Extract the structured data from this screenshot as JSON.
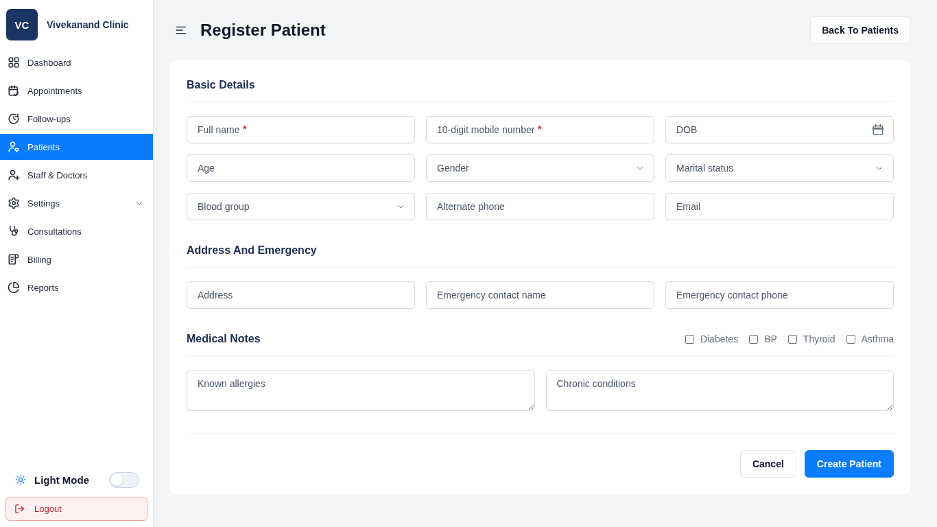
{
  "sidebar": {
    "logo": "VC",
    "brand": "Vivekanand Clinic",
    "nav": [
      {
        "label": "Dashboard",
        "selected": false
      },
      {
        "label": "Appointments",
        "selected": false
      },
      {
        "label": "Follow-ups",
        "selected": false
      },
      {
        "label": "Patients",
        "selected": true
      },
      {
        "label": "Staff & Doctors",
        "selected": false
      },
      {
        "label": "Settings",
        "selected": false,
        "expanded": false
      },
      {
        "label": "Consultations",
        "selected": false
      },
      {
        "label": "Billing",
        "selected": false
      },
      {
        "label": "Reports",
        "selected": false
      }
    ],
    "theme_toggle": {
      "label": "Light Mode",
      "on": false
    },
    "logout": "Logout"
  },
  "header": {
    "title": "Register Patient",
    "back_button": "Back To Patients"
  },
  "form": {
    "sections": [
      {
        "title": "Basic Details",
        "fields": [
          {
            "kind": "text",
            "placeholder": "Full name",
            "required_mark": "*"
          },
          {
            "kind": "text",
            "placeholder": "10-digit mobile number",
            "required_mark": "*"
          },
          {
            "kind": "date",
            "placeholder": "DOB"
          },
          {
            "kind": "text",
            "placeholder": "Age"
          },
          {
            "kind": "select",
            "placeholder": "Gender"
          },
          {
            "kind": "select",
            "placeholder": "Marital status"
          },
          {
            "kind": "select",
            "placeholder": "Blood group"
          },
          {
            "kind": "text",
            "placeholder": "Alternate phone"
          },
          {
            "kind": "text",
            "placeholder": "Email"
          }
        ]
      },
      {
        "title": "Address And Emergency",
        "fields": [
          {
            "kind": "text",
            "placeholder": "Address"
          },
          {
            "kind": "text",
            "placeholder": "Emergency contact name"
          },
          {
            "kind": "text",
            "placeholder": "Emergency contact phone"
          }
        ]
      },
      {
        "title": "Medical Notes",
        "conditions": [
          {
            "label": "Diabetes",
            "checked": false
          },
          {
            "label": "BP",
            "checked": false
          },
          {
            "label": "Thyroid",
            "checked": false
          },
          {
            "label": "Asthma",
            "checked": false
          }
        ],
        "fields": [
          {
            "kind": "textarea",
            "placeholder": "Known allergies"
          },
          {
            "kind": "textarea",
            "placeholder": "Chronic conditions"
          }
        ]
      }
    ],
    "actions": [
      {
        "kind": "secondary",
        "label": "Cancel"
      },
      {
        "kind": "primary",
        "label": "Create Patient"
      }
    ]
  }
}
